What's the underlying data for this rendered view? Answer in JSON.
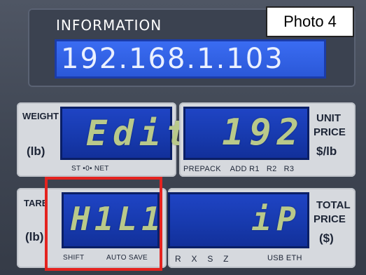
{
  "photo_label": "Photo 4",
  "info": {
    "title": "INFORMATION",
    "ip": "192.168.1.103"
  },
  "weight": {
    "label": "WEIGHT",
    "unit": "(lb)",
    "display": "Edit",
    "indicators": "ST  •0•  NET"
  },
  "unit_price": {
    "label_line1": "UNIT",
    "label_line2": "PRICE",
    "unit": "$/lb",
    "display": "192",
    "indicators": "PREPACK    ADD R1   R2   R3"
  },
  "tare": {
    "label": "TARE",
    "unit": "(lb)",
    "display": "H1L1",
    "indicator_shift": "SHIFT",
    "indicator_autosave": "AUTO SAVE"
  },
  "total_price": {
    "label_line1": "TOTAL",
    "label_line2": "PRICE",
    "unit": "($)",
    "display": "iP",
    "indicators": "R    X    S    Z",
    "indicator_usb": "USB ETH"
  },
  "colors": {
    "lcd_blue": "#173aae",
    "segment_green": "#b9c98a",
    "highlight_red": "#e4231f"
  }
}
